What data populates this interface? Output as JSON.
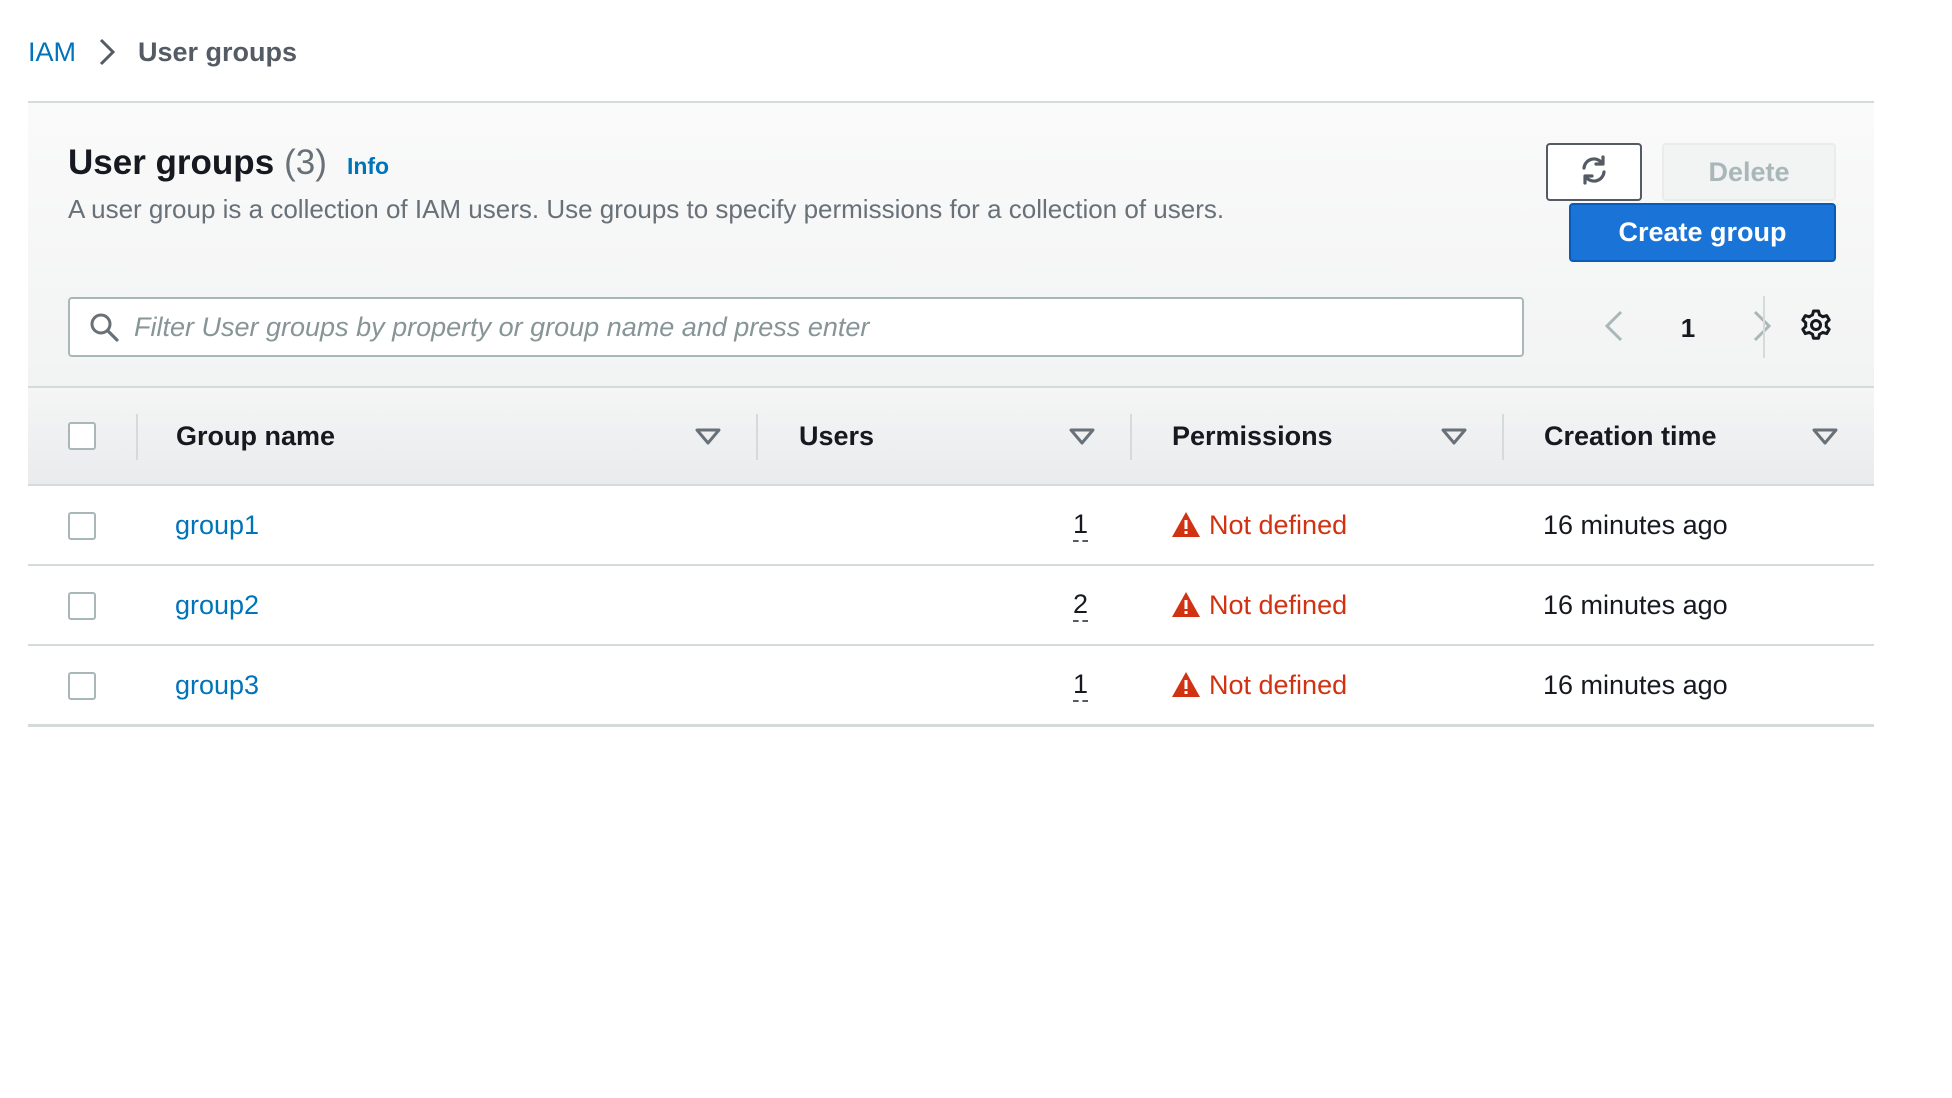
{
  "breadcrumb": {
    "root_label": "IAM",
    "current_label": "User groups"
  },
  "header": {
    "title": "User groups",
    "count": "(3)",
    "info_label": "Info",
    "description": "A user group is a collection of IAM users. Use groups to specify permissions for a collection of users."
  },
  "actions": {
    "refresh_icon": "refresh-icon",
    "delete_label": "Delete",
    "create_label": "Create group"
  },
  "filter": {
    "placeholder": "Filter User groups by property or group name and press enter",
    "value": ""
  },
  "pagination": {
    "current_page": "1"
  },
  "table": {
    "columns": [
      {
        "label": "Group name"
      },
      {
        "label": "Users"
      },
      {
        "label": "Permissions"
      },
      {
        "label": "Creation time"
      }
    ],
    "rows": [
      {
        "name": "group1",
        "users": "1",
        "permissions": "Not defined",
        "created": "16 minutes ago"
      },
      {
        "name": "group2",
        "users": "2",
        "permissions": "Not defined",
        "created": "16 minutes ago"
      },
      {
        "name": "group3",
        "users": "1",
        "permissions": "Not defined",
        "created": "16 minutes ago"
      }
    ]
  },
  "colors": {
    "link": "#0073bb",
    "primary_button": "#1a73d6",
    "warning": "#d13212",
    "muted_text": "#687078"
  }
}
